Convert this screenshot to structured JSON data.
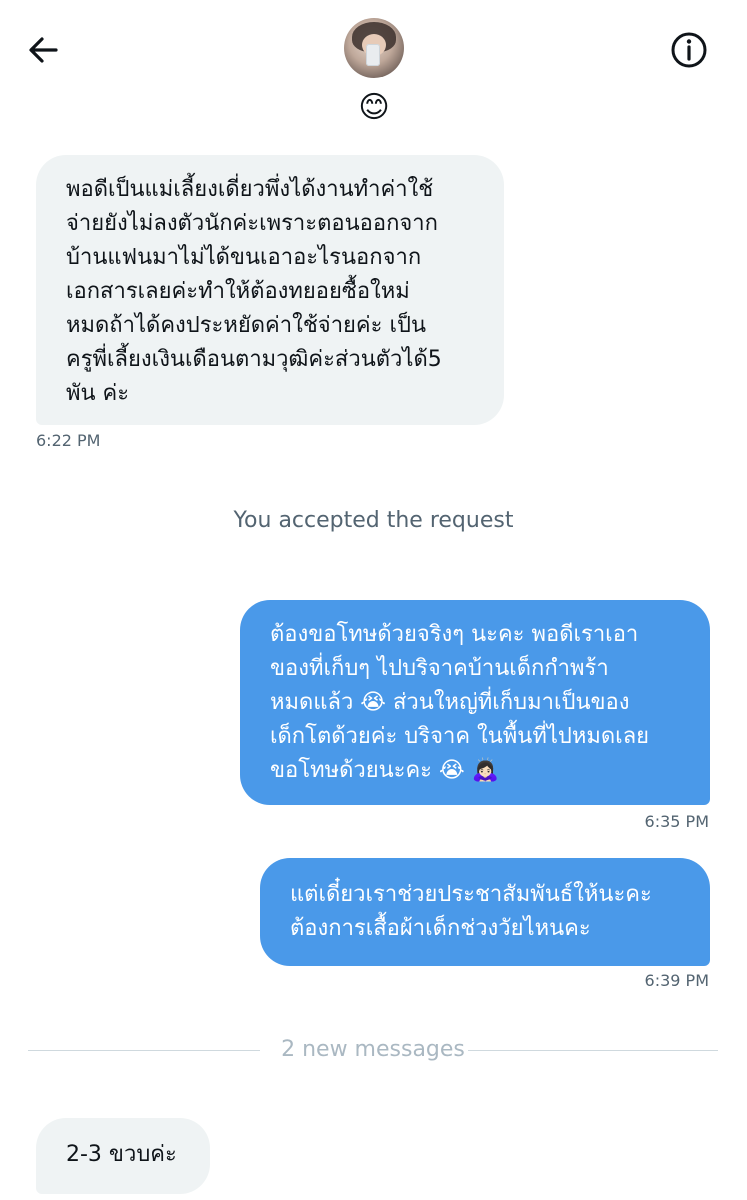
{
  "header": {
    "name_emoji": "😊"
  },
  "messages": [
    {
      "direction": "incoming",
      "text": "พอดีเป็นแม่เลี้ยงเดี่ยวพึ่งได้งานทำค่าใช้\nจ่ายยังไม่ลงตัวนักค่ะเพราะตอนออกจาก\nบ้านแฟนมาไม่ได้ขนเอาอะไรนอกจาก\nเอกสารเลยค่ะทำให้ต้องทยอยซื้อใหม่\nหมดถ้าได้คงประหยัดค่าใช้จ่ายค่ะ เป็น\nครูพี่เลี้ยงเงินเดือนตามวุฒิค่ะส่วนตัวได้5\nพัน ค่ะ",
      "time": "6:22 PM"
    },
    {
      "direction": "outgoing",
      "text": "ต้องขอโทษด้วยจริงๆ นะคะ พอดีเราเอา\nของที่เก็บๆ ไปบริจาคบ้านเด็กกำพร้า\nหมดแล้ว 😭 ส่วนใหญ่ที่เก็บมาเป็นของ\nเด็กโตด้วยค่ะ บริจาค ในพื้นที่ไปหมดเลย\nขอโทษด้วยนะคะ 😭 🙇🏻‍♀️",
      "time": "6:35 PM"
    },
    {
      "direction": "outgoing",
      "text": "แต่เดี๋ยวเราช่วยประชาสัมพันธ์ให้นะคะ\nต้องการเสื้อผ้าเด็กช่วงวัยไหนคะ",
      "time": "6:39 PM"
    },
    {
      "direction": "incoming",
      "text": "2-3 ขวบค่ะ"
    }
  ],
  "system_message": "You accepted the request",
  "new_messages_divider": "2 new messages",
  "colors": {
    "incoming_bubble": "#eff3f4",
    "outgoing_bubble": "#4a99e9",
    "meta_text": "#536471",
    "divider_text": "#aab8c2"
  },
  "icons": {
    "back": "arrow-left-icon",
    "info": "info-circle-icon"
  }
}
